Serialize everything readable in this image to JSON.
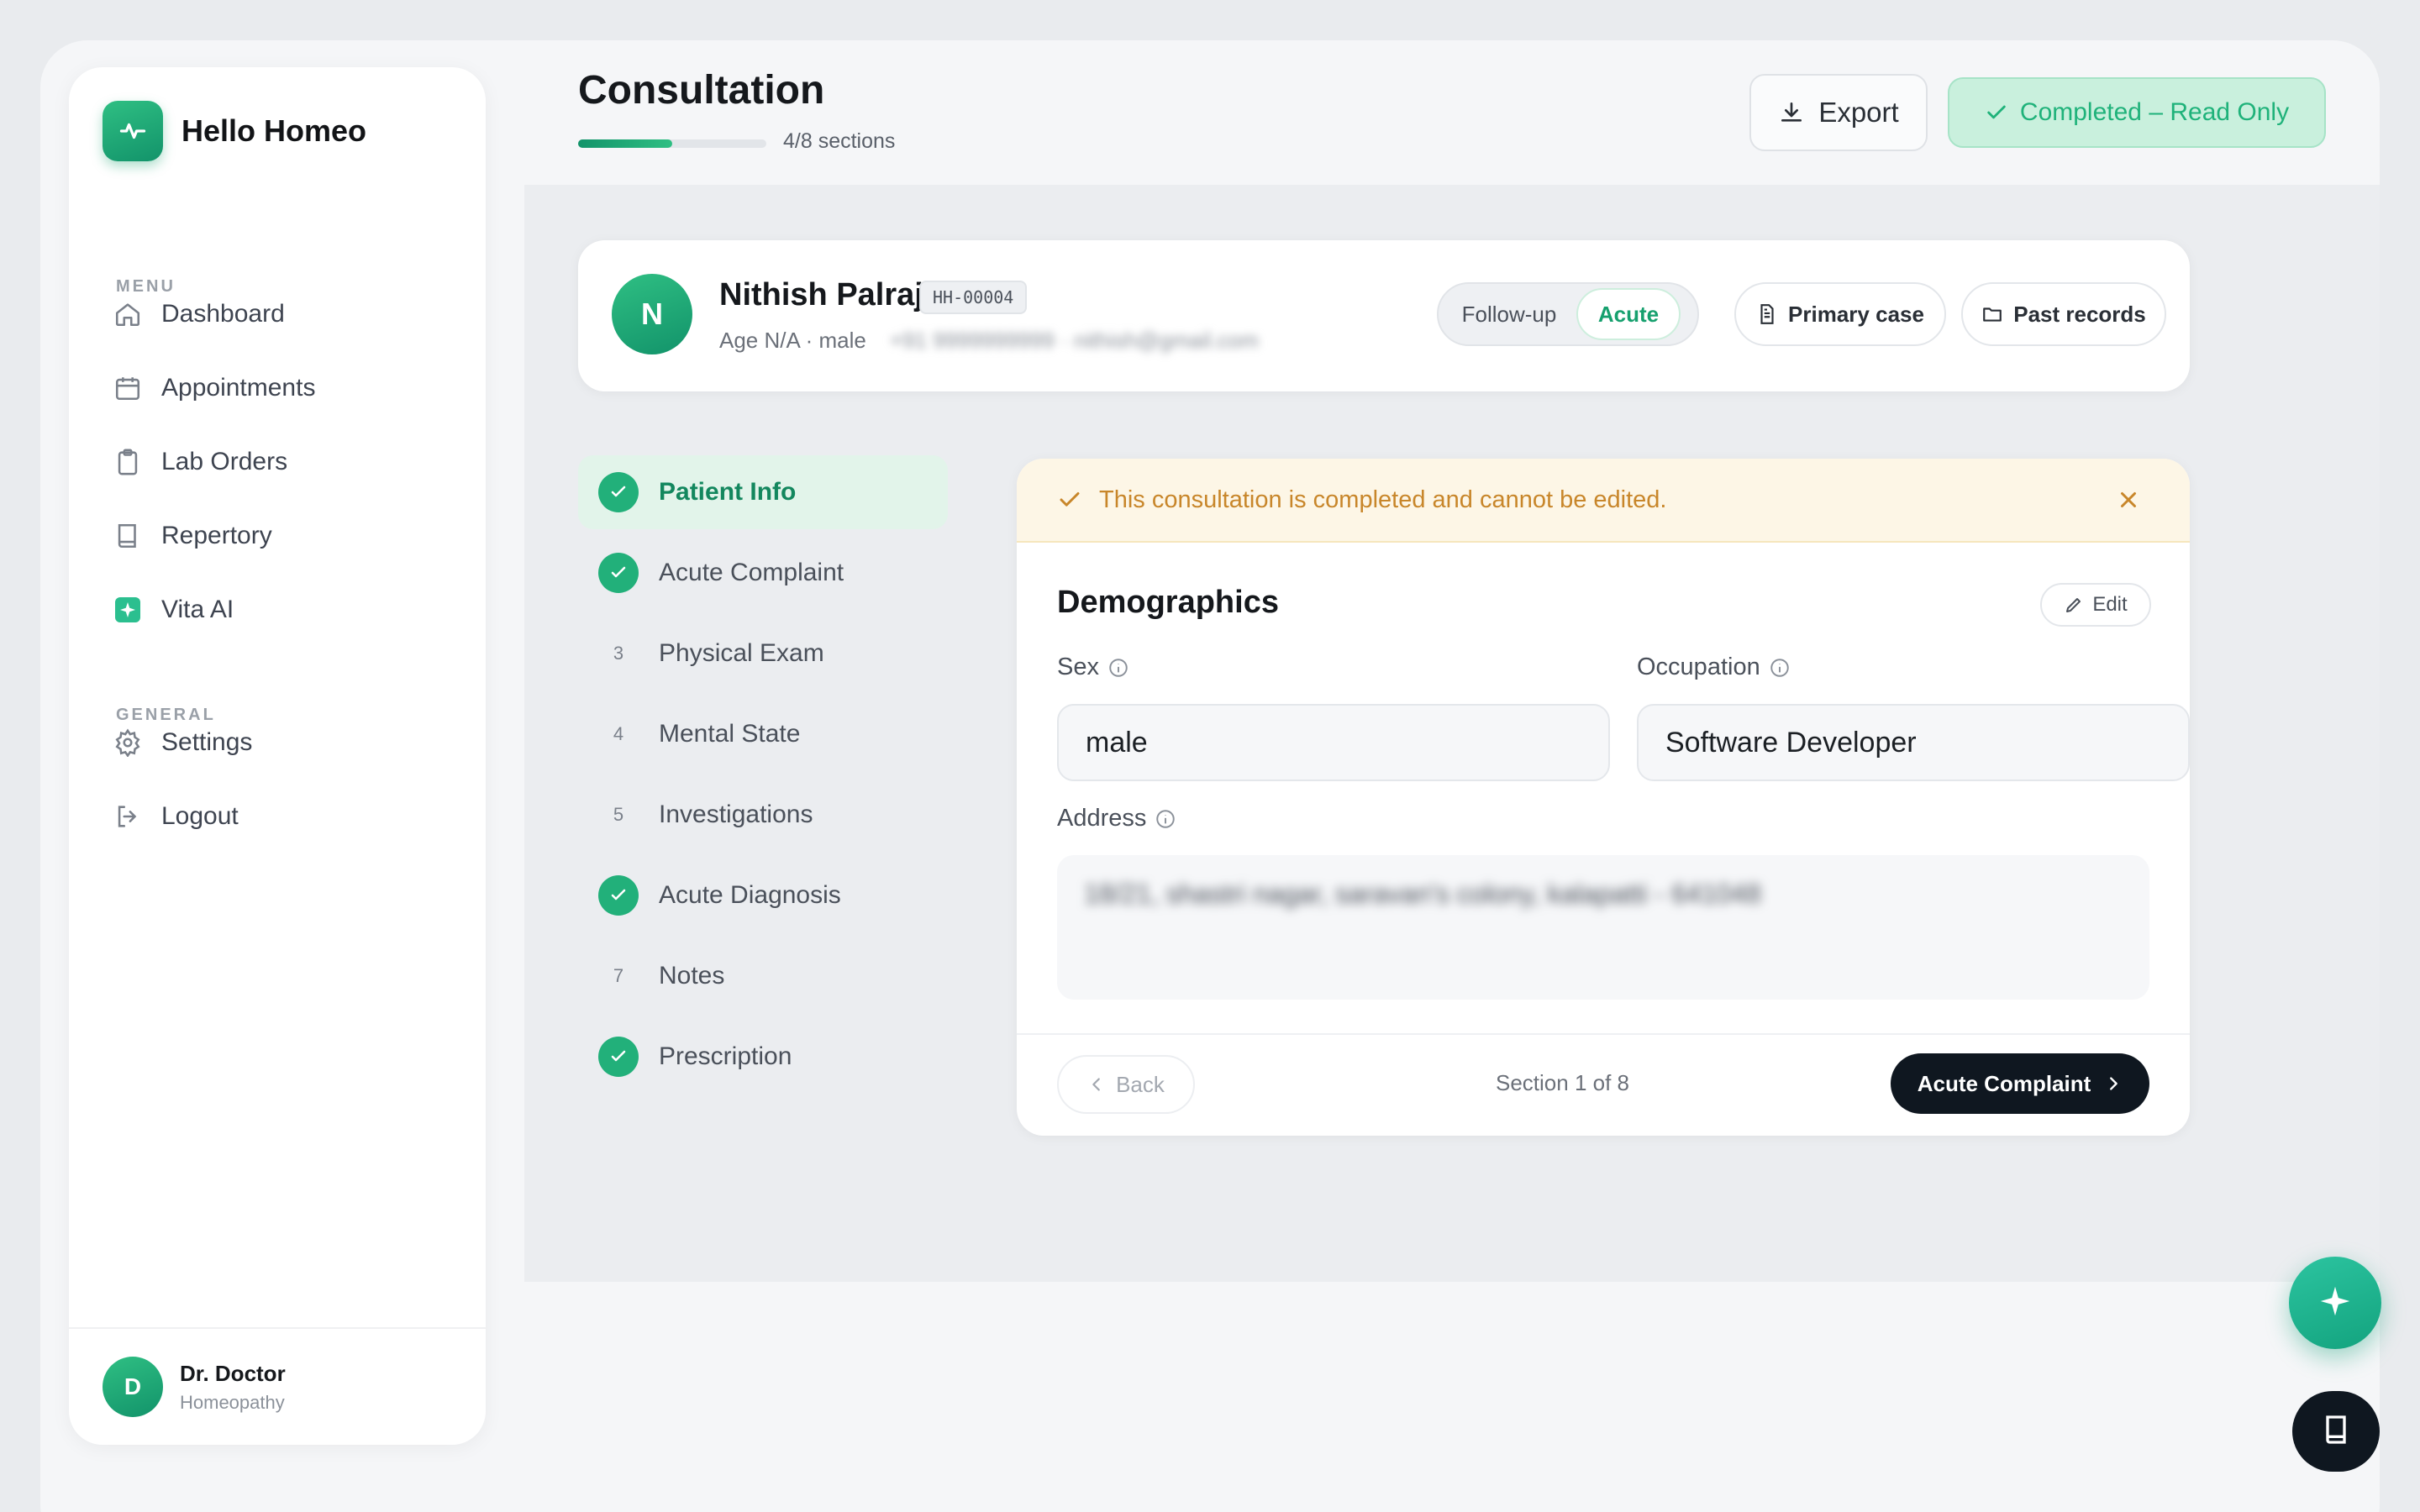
{
  "colors": {
    "accent": "#16A06E",
    "accent_light": "#E2F4EA",
    "warning": "#C8862A",
    "dark": "#0F1720"
  },
  "sidebar": {
    "brand": "Hello Homeo",
    "menu_label": "MENU",
    "general_label": "GENERAL",
    "menu_items": [
      {
        "label": "Dashboard",
        "icon": "home-icon"
      },
      {
        "label": "Appointments",
        "icon": "calendar-icon"
      },
      {
        "label": "Lab Orders",
        "icon": "clipboard-icon"
      },
      {
        "label": "Repertory",
        "icon": "book-icon"
      },
      {
        "label": "Vita AI",
        "icon": "sparkle-icon"
      }
    ],
    "general_items": [
      {
        "label": "Settings",
        "icon": "gear-icon"
      },
      {
        "label": "Logout",
        "icon": "logout-icon"
      }
    ],
    "user": {
      "initial": "D",
      "name": "Dr. Doctor",
      "role": "Homeopathy"
    }
  },
  "header": {
    "title": "Consultation",
    "progress_text": "4/8 sections",
    "progress_fraction": 0.5,
    "export_label": "Export",
    "status_label": "Completed – Read Only"
  },
  "patient": {
    "initial": "N",
    "name": "Nithish Palraj",
    "id": "HH-00004",
    "meta": "Age N/A · male",
    "contact_redacted": "+91 9999999999 · nithish@gmail.com",
    "visit_types": [
      "Follow-up",
      "Acute"
    ],
    "selected_visit_type": "Acute",
    "primary_case_label": "Primary case",
    "past_records_label": "Past records"
  },
  "steps": [
    {
      "number": "1",
      "label": "Patient Info",
      "done": true,
      "active": true
    },
    {
      "number": "2",
      "label": "Acute Complaint",
      "done": true,
      "active": false
    },
    {
      "number": "3",
      "label": "Physical Exam",
      "done": false,
      "active": false
    },
    {
      "number": "4",
      "label": "Mental State",
      "done": false,
      "active": false
    },
    {
      "number": "5",
      "label": "Investigations",
      "done": false,
      "active": false
    },
    {
      "number": "6",
      "label": "Acute Diagnosis",
      "done": true,
      "active": false
    },
    {
      "number": "7",
      "label": "Notes",
      "done": false,
      "active": false
    },
    {
      "number": "8",
      "label": "Prescription",
      "done": true,
      "active": false
    }
  ],
  "form": {
    "alert": "This consultation is completed and cannot be edited.",
    "title": "Demographics",
    "edit_label": "Edit",
    "sex_label": "Sex",
    "sex_value": "male",
    "occupation_label": "Occupation",
    "occupation_value": "Software Developer",
    "address_label": "Address",
    "address_redacted": "18/21, shastri nagar, saravan's colony, kalapatti - 641048",
    "back_label": "Back",
    "section_indicator": "Section 1 of 8",
    "next_label": "Acute Complaint"
  }
}
